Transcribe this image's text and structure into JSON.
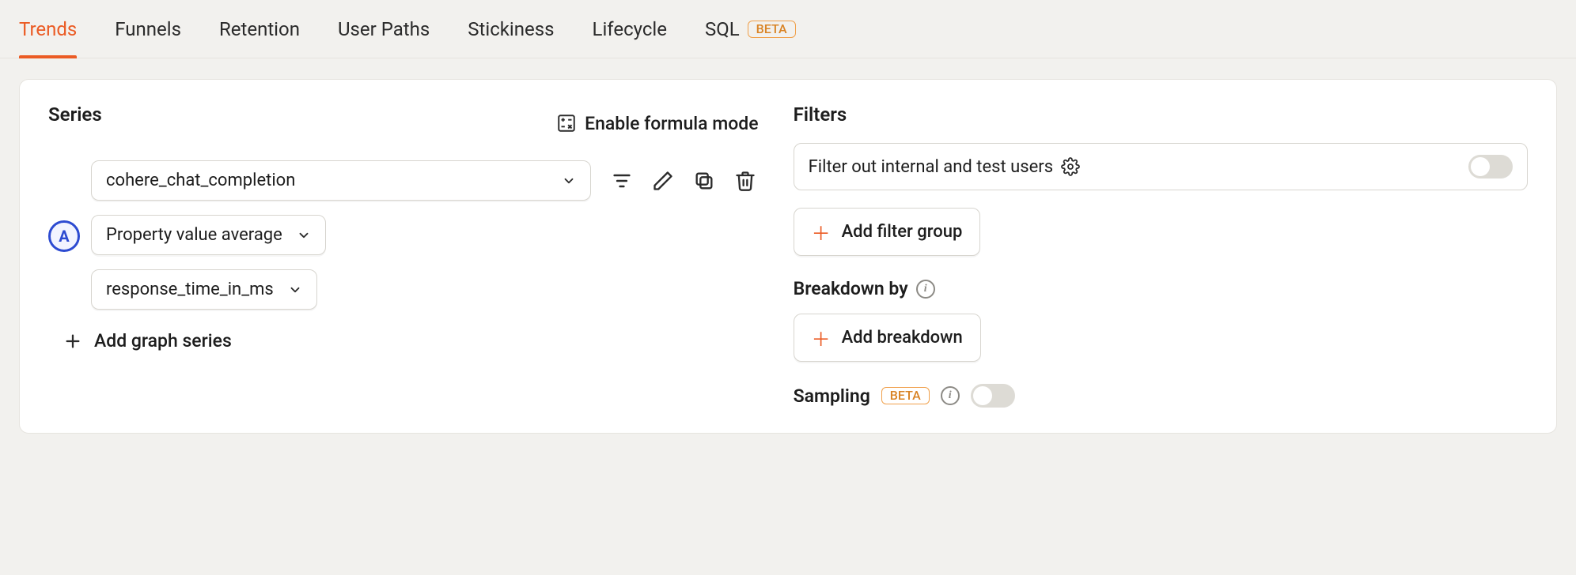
{
  "tabs": [
    {
      "label": "Trends",
      "active": true
    },
    {
      "label": "Funnels",
      "active": false
    },
    {
      "label": "Retention",
      "active": false
    },
    {
      "label": "User Paths",
      "active": false
    },
    {
      "label": "Stickiness",
      "active": false
    },
    {
      "label": "Lifecycle",
      "active": false
    },
    {
      "label": "SQL",
      "active": false,
      "badge": "BETA"
    }
  ],
  "left": {
    "title": "Series",
    "formula_label": "Enable formula mode",
    "series": {
      "letter": "A",
      "event": "cohere_chat_completion",
      "aggregation": "Property value average",
      "property": "response_time_in_ms"
    },
    "add_series_label": "Add graph series"
  },
  "right": {
    "filters_title": "Filters",
    "internal_filter_label": "Filter out internal and test users",
    "add_filter_group_label": "Add filter group",
    "breakdown_title": "Breakdown by",
    "add_breakdown_label": "Add breakdown",
    "sampling_title": "Sampling",
    "sampling_badge": "BETA"
  }
}
